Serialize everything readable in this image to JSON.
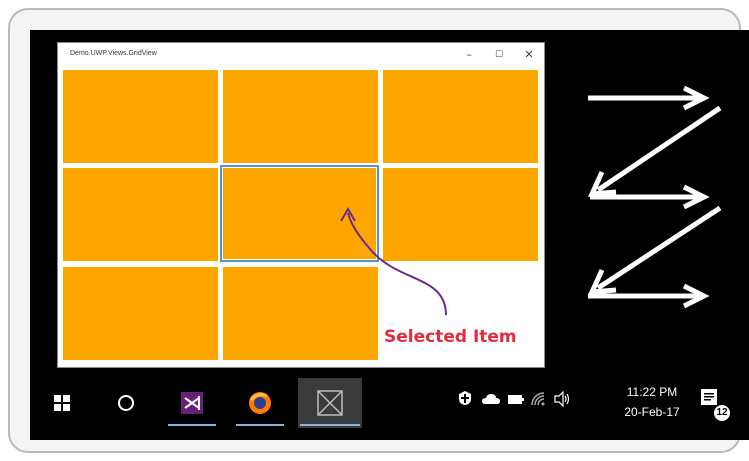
{
  "window": {
    "title": "Demo.UWP.Views.GridView",
    "minimize_glyph": "–",
    "maximize_glyph": "☐",
    "close_glyph": "✕"
  },
  "grid": {
    "tile_color": "#ffa500",
    "selected_border_color": "#4f97c7",
    "item_count": 8,
    "selected_index": 4
  },
  "annotation": {
    "label": "Selected Item",
    "color": "#e8283b",
    "arrow_color": "#6a2c8a"
  },
  "taskbar": {
    "icons": [
      "windows-start-icon",
      "cortana-search-icon",
      "visual-studio-rc-icon",
      "firefox-icon",
      "uwp-app-icon"
    ],
    "tray_icons": [
      "shield-icon",
      "onedrive-cloud-icon",
      "battery-icon",
      "wifi-icon",
      "speaker-icon"
    ],
    "time": "11:22 PM",
    "date": "20-Feb-17",
    "notification_count": "12",
    "notification_icon": "action-center-icon"
  },
  "layout_hint": {
    "flow_direction_arrows": "white zig-zag arrows indicating row-wise item ordering",
    "arrow_color": "#ffffff"
  }
}
